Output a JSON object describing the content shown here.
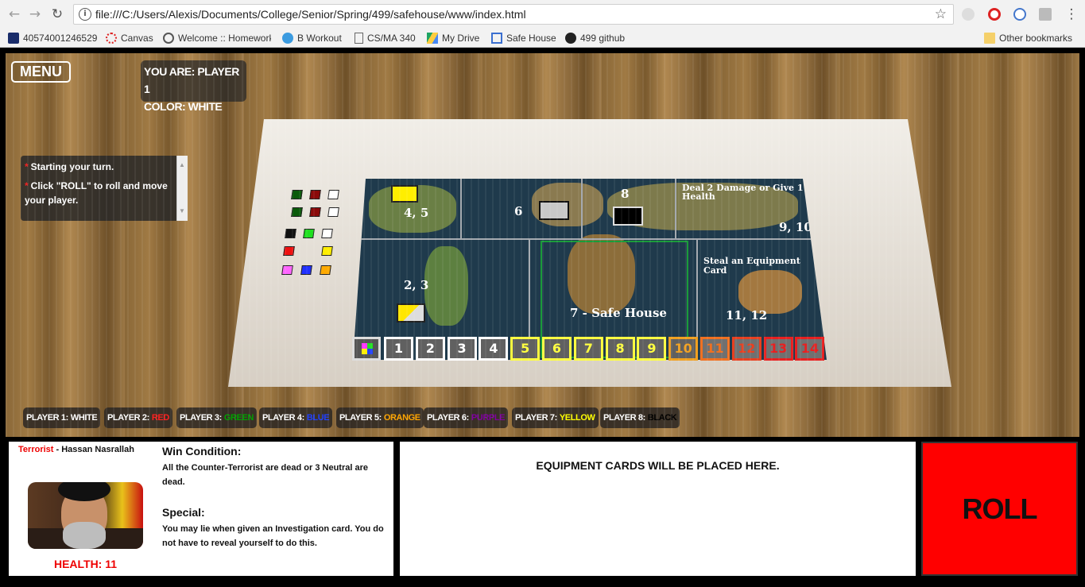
{
  "browser": {
    "url": "file:///C:/Users/Alexis/Documents/College/Senior/Spring/499/safehouse/www/index.html",
    "bookmarks": [
      {
        "label": "40574001246529",
        "icon": "bookmark-icon-i"
      },
      {
        "label": "Canvas",
        "icon": "canvas-icon"
      },
      {
        "label": "Welcome :: Homework",
        "icon": "homework-icon"
      },
      {
        "label": "B Workout",
        "icon": "workout-icon"
      },
      {
        "label": "CS/MA 340",
        "icon": "document-icon"
      },
      {
        "label": "My Drive",
        "icon": "drive-icon"
      },
      {
        "label": "Safe House",
        "icon": "page-icon"
      },
      {
        "label": "499 github",
        "icon": "github-icon"
      }
    ],
    "other_bookmarks": "Other bookmarks"
  },
  "game": {
    "menu_label": "MENU",
    "you_are": "YOU ARE: PLAYER 1",
    "color": "COLOR: WHITE",
    "log": [
      "Starting your turn.",
      "Click \"ROLL\" to roll and move your player."
    ],
    "map_labels": {
      "zone_45": "4, 5",
      "zone_6": "6",
      "zone_8": "8",
      "zone_910_title": "Deal 2 Damage or Give 1 Health",
      "zone_910": "9, 10",
      "zone_23": "2, 3",
      "zone_7": "7 - Safe House",
      "zone_1112_title": "Steal an Equipment Card",
      "zone_1112": "11, 12"
    },
    "track": [
      "1",
      "2",
      "3",
      "4",
      "5",
      "6",
      "7",
      "8",
      "9",
      "10",
      "11",
      "12",
      "13",
      "14"
    ],
    "track_colors": [
      "#ffffff",
      "#ffffff",
      "#ffffff",
      "#ffffff",
      "#ffff40",
      "#ffff40",
      "#ffff40",
      "#ffff40",
      "#ffff40",
      "#f0a020",
      "#f07020",
      "#e84020",
      "#e82020",
      "#e82020"
    ],
    "players": [
      {
        "label": "PLAYER 1:",
        "color_name": "WHITE",
        "color": "#ffffff"
      },
      {
        "label": "PLAYER 2:",
        "color_name": "RED",
        "color": "#ff2020"
      },
      {
        "label": "PLAYER 3:",
        "color_name": "GREEN",
        "color": "#00a000"
      },
      {
        "label": "PLAYER 4:",
        "color_name": "BLUE",
        "color": "#2040ff"
      },
      {
        "label": "PLAYER 5:",
        "color_name": "ORANGE",
        "color": "#ffa500"
      },
      {
        "label": "PLAYER 6:",
        "color_name": "PURPLE",
        "color": "#8000a0"
      },
      {
        "label": "PLAYER 7:",
        "color_name": "YELLOW",
        "color": "#ffff00"
      },
      {
        "label": "PLAYER 8:",
        "color_name": "BLACK",
        "color": "#000000"
      }
    ]
  },
  "character": {
    "role": "Terrorist",
    "name": " - Hassan Nasrallah",
    "health": "HEALTH: 11",
    "win_heading": "Win Condition:",
    "win_text": "All the Counter-Terrorist are dead or 3 Neutral are dead.",
    "special_heading": "Special:",
    "special_text": "You may lie when given an Investigation card. You do not have to reveal yourself to do this."
  },
  "equipment": {
    "placeholder": "EQUIPMENT CARDS WILL BE PLACED HERE."
  },
  "roll": {
    "label": "ROLL"
  }
}
